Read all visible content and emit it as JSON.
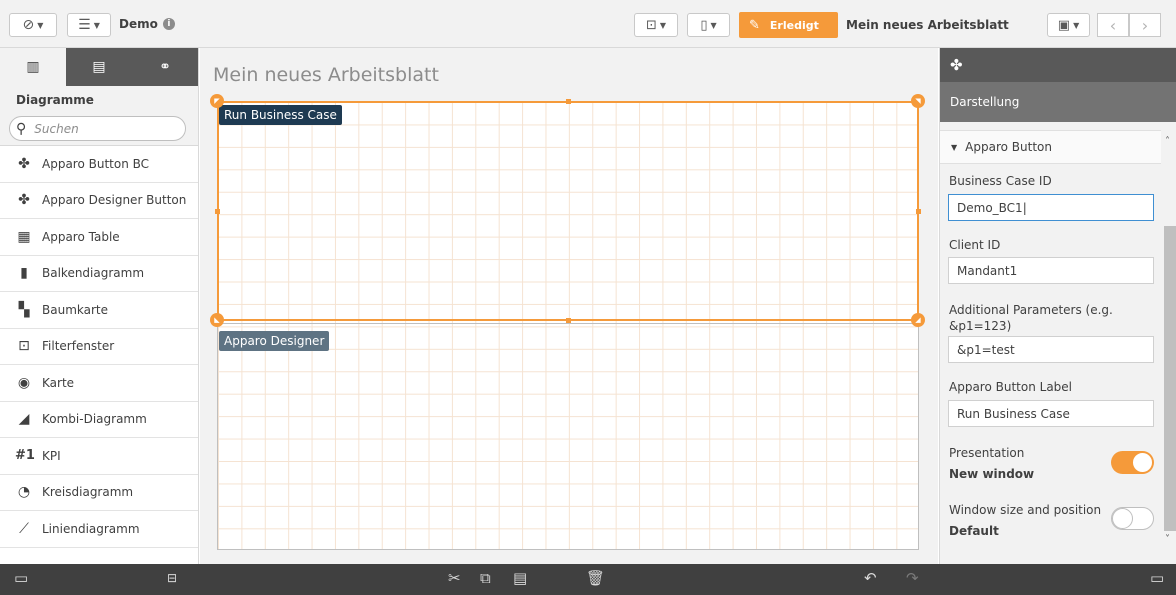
{
  "toolbar": {
    "app_name": "Demo",
    "info_glyph": "i",
    "erledigt_label": "Erledigt",
    "sheet_title": "Mein neues Arbeitsblatt",
    "prev_glyph": "‹",
    "next_glyph": "›"
  },
  "left_panel": {
    "heading": "Diagramme",
    "search_placeholder": "Suchen",
    "items": [
      {
        "label": "Apparo Button BC",
        "icon": "puzzle-icon",
        "glyph": "✤"
      },
      {
        "label": "Apparo Designer Button",
        "icon": "puzzle-icon",
        "glyph": "✤"
      },
      {
        "label": "Apparo Table",
        "icon": "table-icon",
        "glyph": "▦"
      },
      {
        "label": "Balkendiagramm",
        "icon": "bar-chart-icon",
        "glyph": "▮"
      },
      {
        "label": "Baumkarte",
        "icon": "treemap-icon",
        "glyph": "▚"
      },
      {
        "label": "Filterfenster",
        "icon": "filter-pane-icon",
        "glyph": "⊡"
      },
      {
        "label": "Karte",
        "icon": "globe-icon",
        "glyph": "◉"
      },
      {
        "label": "Kombi-Diagramm",
        "icon": "combo-chart-icon",
        "glyph": "◢"
      },
      {
        "label": "KPI",
        "icon": "kpi-icon",
        "glyph": "#1"
      },
      {
        "label": "Kreisdiagramm",
        "icon": "pie-chart-icon",
        "glyph": "◔"
      },
      {
        "label": "Liniendiagramm",
        "icon": "line-chart-icon",
        "glyph": "⟋"
      }
    ]
  },
  "canvas": {
    "sheet_name": "Mein neues Arbeitsblatt",
    "object1_label": "Run Business Case",
    "object2_label": "Apparo Designer"
  },
  "right_panel": {
    "section_tab": "Darstellung",
    "group_title": "Apparo Button",
    "business_case_id_label": "Business Case ID",
    "business_case_id_value": "Demo_BC1",
    "client_id_label": "Client ID",
    "client_id_value": "Mandant1",
    "additional_params_label": "Additional Parameters (e.g. &p1=123)",
    "additional_params_value": "&p1=test",
    "button_label_label": "Apparo Button Label",
    "button_label_value": "Run Business Case",
    "presentation_label": "Presentation",
    "presentation_value": "New window",
    "presentation_on": true,
    "window_size_label": "Window size and position",
    "window_size_value": "Default",
    "window_size_on": false
  },
  "colors": {
    "accent": "#f59a3a",
    "dark_bar": "#404040",
    "object1_label_bg": "#1e3a52",
    "object2_label_bg": "#5e7383"
  }
}
